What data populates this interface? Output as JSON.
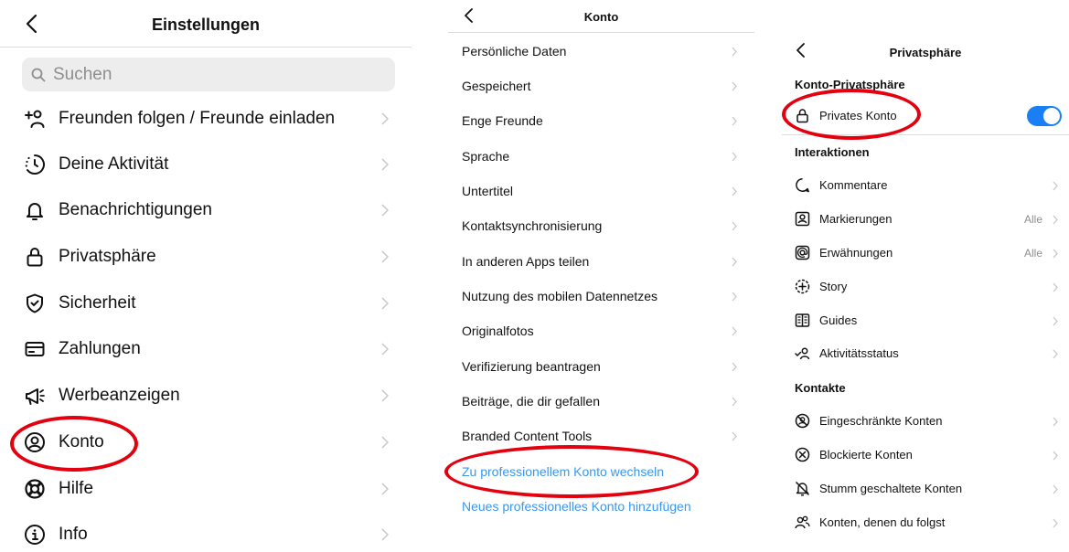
{
  "settings": {
    "title": "Einstellungen",
    "search_placeholder": "Suchen",
    "items": [
      {
        "label": "Freunden folgen / Freunde einladen",
        "icon": "add-person-icon"
      },
      {
        "label": "Deine Aktivität",
        "icon": "activity-clock-icon"
      },
      {
        "label": "Benachrichtigungen",
        "icon": "bell-icon"
      },
      {
        "label": "Privatsphäre",
        "icon": "lock-icon"
      },
      {
        "label": "Sicherheit",
        "icon": "shield-check-icon"
      },
      {
        "label": "Zahlungen",
        "icon": "credit-card-icon"
      },
      {
        "label": "Werbeanzeigen",
        "icon": "megaphone-icon"
      },
      {
        "label": "Konto",
        "icon": "account-circle-icon"
      },
      {
        "label": "Hilfe",
        "icon": "lifebuoy-icon"
      },
      {
        "label": "Info",
        "icon": "info-icon"
      }
    ]
  },
  "account": {
    "title": "Konto",
    "items": [
      {
        "label": "Persönliche Daten"
      },
      {
        "label": "Gespeichert"
      },
      {
        "label": "Enge Freunde"
      },
      {
        "label": "Sprache"
      },
      {
        "label": "Untertitel"
      },
      {
        "label": "Kontaktsynchronisierung"
      },
      {
        "label": "In anderen Apps teilen"
      },
      {
        "label": "Nutzung des mobilen Datennetzes"
      },
      {
        "label": "Originalfotos"
      },
      {
        "label": "Verifizierung beantragen"
      },
      {
        "label": "Beiträge, die dir gefallen"
      },
      {
        "label": "Branded Content Tools"
      }
    ],
    "link_professional": "Zu professionellem Konto wechseln",
    "link_add_professional": "Neues professionelles Konto hinzufügen"
  },
  "privacy": {
    "title": "Privatsphäre",
    "section_account_privacy": "Konto-Privatsphäre",
    "private_account_label": "Privates Konto",
    "private_account_on": true,
    "section_interactions": "Interaktionen",
    "interactions": [
      {
        "label": "Kommentare",
        "value": "",
        "icon": "comment-bubble-icon"
      },
      {
        "label": "Markierungen",
        "value": "Alle",
        "icon": "tag-person-icon"
      },
      {
        "label": "Erwähnungen",
        "value": "Alle",
        "icon": "at-sign-icon"
      },
      {
        "label": "Story",
        "value": "",
        "icon": "story-plus-icon"
      },
      {
        "label": "Guides",
        "value": "",
        "icon": "guide-book-icon"
      },
      {
        "label": "Aktivitätsstatus",
        "value": "",
        "icon": "activity-status-icon"
      }
    ],
    "section_contacts": "Kontakte",
    "contacts": [
      {
        "label": "Eingeschränkte Konten",
        "icon": "restricted-icon"
      },
      {
        "label": "Blockierte Konten",
        "icon": "blocked-icon"
      },
      {
        "label": "Stumm geschaltete Konten",
        "icon": "muted-bell-icon"
      },
      {
        "label": "Konten, denen du folgst",
        "icon": "following-people-icon"
      }
    ]
  },
  "colors": {
    "accent_blue": "#3897f0",
    "toggle_blue": "#1a7ff4",
    "annotation_red": "#e3000f",
    "chevron_gray": "#c7c7cc"
  }
}
